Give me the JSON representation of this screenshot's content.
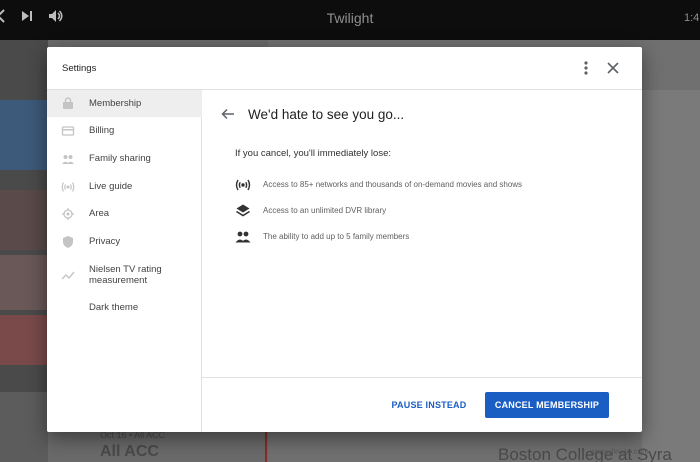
{
  "app": {
    "title": "Twilight",
    "clock": "1:4"
  },
  "background": {
    "item_date": "Oct 16 • All ACC",
    "item_title": "All ACC",
    "right_headline": "Boston College at Syra",
    "watermark": "www.deuaq.com"
  },
  "dialog": {
    "title": "Settings",
    "more_icon": "more-vert-icon",
    "close_icon": "close-icon"
  },
  "sidebar": {
    "items": [
      {
        "label": "Membership",
        "icon": "membership-icon",
        "active": true
      },
      {
        "label": "Billing",
        "icon": "credit-card-icon",
        "active": false
      },
      {
        "label": "Family sharing",
        "icon": "people-icon",
        "active": false
      },
      {
        "label": "Live guide",
        "icon": "live-signal-icon",
        "active": false
      },
      {
        "label": "Area",
        "icon": "location-icon",
        "active": false
      },
      {
        "label": "Privacy",
        "icon": "shield-icon",
        "active": false
      },
      {
        "label": "Nielsen TV rating measurement",
        "icon": "trending-icon",
        "active": false
      },
      {
        "label": "Dark theme",
        "icon": "moon-icon",
        "active": false
      }
    ]
  },
  "content": {
    "heading": "We'd hate to see you go...",
    "intro": "If you cancel, you'll immediately lose:",
    "losses": [
      {
        "text": "Access to 85+ networks and thousands of on-demand movies and shows",
        "icon": "live-signal-icon"
      },
      {
        "text": "Access to an unlimited DVR library",
        "icon": "library-layers-icon"
      },
      {
        "text": "The ability to add up to 5 family members",
        "icon": "people-icon"
      }
    ]
  },
  "footer": {
    "pause_label": "PAUSE INSTEAD",
    "cancel_label": "CANCEL MEMBERSHIP"
  },
  "colors": {
    "accent": "#1a5ec4",
    "active_item": "#eeeeee",
    "overlay": "#6e6e6e"
  }
}
